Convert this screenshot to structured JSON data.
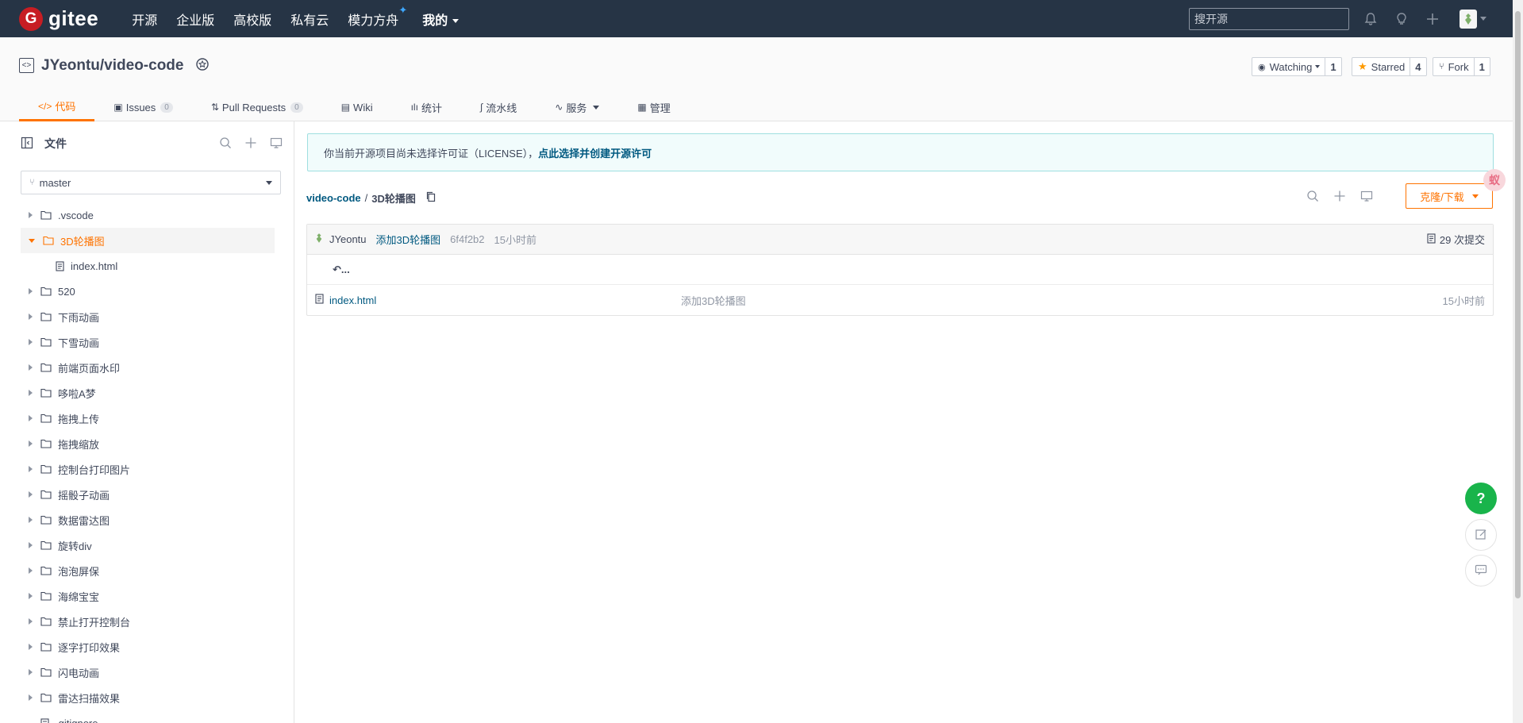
{
  "nav": {
    "logo_text": "gitee",
    "links": [
      "开源",
      "企业版",
      "高校版",
      "私有云",
      "模力方舟"
    ],
    "mine": "我的",
    "search_placeholder": "搜开源"
  },
  "project": {
    "title": "JYeontu/video-code",
    "watching_label": "Watching",
    "watching_count": "1",
    "starred_label": "Starred",
    "starred_count": "4",
    "fork_label": "Fork",
    "fork_count": "1"
  },
  "tabs": [
    {
      "label": "代码",
      "icon": "code-icon"
    },
    {
      "label": "Issues",
      "count": "0",
      "icon": "issue-icon"
    },
    {
      "label": "Pull Requests",
      "count": "0",
      "icon": "pr-icon"
    },
    {
      "label": "Wiki",
      "icon": "book-icon"
    },
    {
      "label": "统计",
      "icon": "chart-icon"
    },
    {
      "label": "流水线",
      "icon": "pipeline-icon"
    },
    {
      "label": "服务",
      "icon": "pulse-icon"
    },
    {
      "label": "管理",
      "icon": "settings-doc-icon"
    }
  ],
  "sidebar": {
    "title": "文件",
    "branch": "master",
    "tree": [
      {
        "label": ".vscode",
        "type": "folder"
      },
      {
        "label": "3D轮播图",
        "type": "folder-open"
      },
      {
        "label": "index.html",
        "type": "file"
      },
      {
        "label": "520",
        "type": "folder"
      },
      {
        "label": "下雨动画",
        "type": "folder"
      },
      {
        "label": "下雪动画",
        "type": "folder"
      },
      {
        "label": "前端页面水印",
        "type": "folder"
      },
      {
        "label": "哆啦A梦",
        "type": "folder"
      },
      {
        "label": "拖拽上传",
        "type": "folder"
      },
      {
        "label": "拖拽缩放",
        "type": "folder"
      },
      {
        "label": "控制台打印图片",
        "type": "folder"
      },
      {
        "label": "摇骰子动画",
        "type": "folder"
      },
      {
        "label": "数据雷达图",
        "type": "folder"
      },
      {
        "label": "旋转div",
        "type": "folder"
      },
      {
        "label": "泡泡屏保",
        "type": "folder"
      },
      {
        "label": "海绵宝宝",
        "type": "folder"
      },
      {
        "label": "禁止打开控制台",
        "type": "folder"
      },
      {
        "label": "逐字打印效果",
        "type": "folder"
      },
      {
        "label": "闪电动画",
        "type": "folder"
      },
      {
        "label": "雷达扫描效果",
        "type": "folder"
      },
      {
        "label": ".gitignore",
        "type": "file"
      }
    ]
  },
  "license": {
    "text": "你当前开源项目尚未选择许可证（LICENSE），",
    "link": "点此选择并创建开源许可"
  },
  "breadcrumb": {
    "repo": "video-code",
    "sep": "/",
    "dir": "3D轮播图"
  },
  "clone_label": "克隆/下载",
  "float_avatar_text": "蚁",
  "commit": {
    "user": "JYeontu",
    "message": "添加3D轮播图",
    "sha": "6f4f2b2",
    "time": "15小时前",
    "count_label": "29 次提交"
  },
  "files": {
    "back_label": "...",
    "rows": [
      {
        "name": "index.html",
        "message": "添加3D轮播图",
        "time": "15小时前"
      }
    ]
  },
  "help_label": "?"
}
